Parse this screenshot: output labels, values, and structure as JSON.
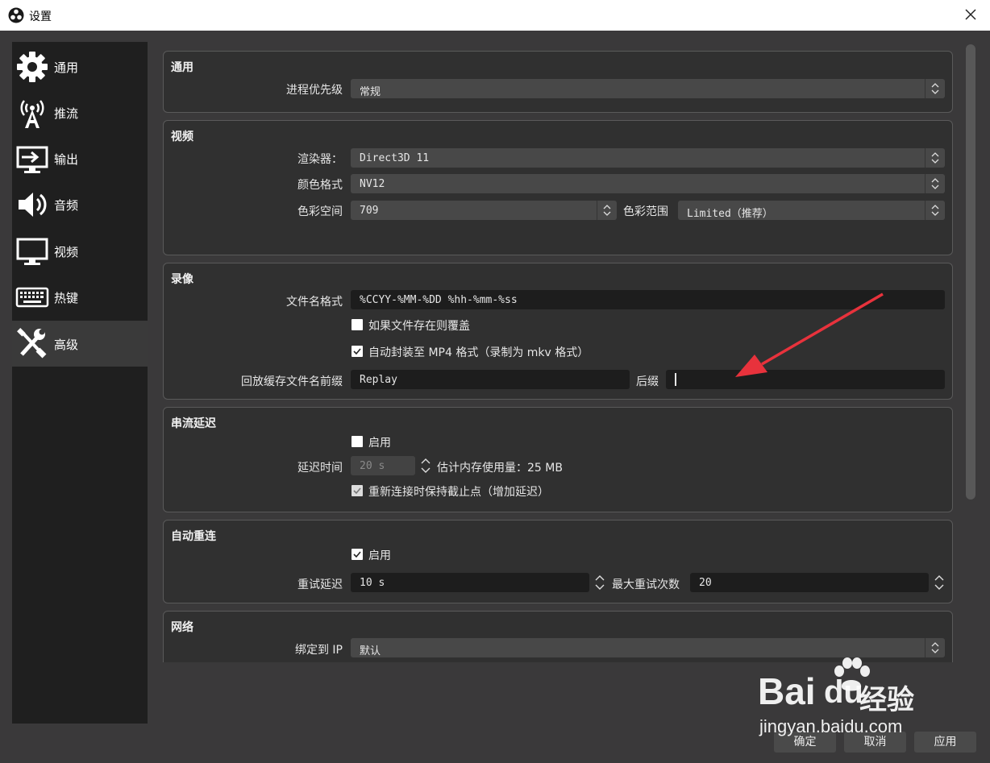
{
  "window": {
    "title": "设置"
  },
  "sidebar": {
    "items": [
      {
        "label": "通用",
        "icon": "gear-icon"
      },
      {
        "label": "推流",
        "icon": "broadcast-icon"
      },
      {
        "label": "输出",
        "icon": "output-icon"
      },
      {
        "label": "音频",
        "icon": "speaker-icon"
      },
      {
        "label": "视频",
        "icon": "monitor-icon"
      },
      {
        "label": "热键",
        "icon": "keyboard-icon"
      },
      {
        "label": "高级",
        "icon": "tools-icon",
        "active": true
      }
    ]
  },
  "general": {
    "title": "通用",
    "priority_label": "进程优先级",
    "priority_value": "常规"
  },
  "video": {
    "title": "视频",
    "renderer_label": "渲染器：",
    "renderer_value": "Direct3D 11",
    "color_format_label": "颜色格式",
    "color_format_value": "NV12",
    "color_space_label": "色彩空间",
    "color_space_value": "709",
    "color_range_label": "色彩范围",
    "color_range_value": "Limited（推荐）"
  },
  "recording": {
    "title": "录像",
    "filename_label": "文件名格式",
    "filename_value": "%CCYY-%MM-%DD %hh-%mm-%ss",
    "overwrite_label": "如果文件存在则覆盖",
    "overwrite_checked": false,
    "remux_label": "自动封装至 MP4 格式（录制为 mkv 格式）",
    "remux_checked": true,
    "replay_prefix_label": "回放缓存文件名前缀",
    "replay_prefix_value": "Replay",
    "suffix_label": "后缀",
    "suffix_value": ""
  },
  "stream_delay": {
    "title": "串流延迟",
    "enable_label": "启用",
    "enable_checked": false,
    "delay_label": "延迟时间",
    "delay_value": "20 s",
    "memory_label": "估计内存使用量：25 MB",
    "preserve_label": "重新连接时保持截止点（增加延迟）",
    "preserve_checked": true
  },
  "reconnect": {
    "title": "自动重连",
    "enable_label": "启用",
    "enable_checked": true,
    "retry_delay_label": "重试延迟",
    "retry_delay_value": "10 s",
    "max_retries_label": "最大重试次数",
    "max_retries_value": "20"
  },
  "network": {
    "title": "网络",
    "bind_ip_label": "绑定到 IP",
    "bind_ip_value": "默认"
  },
  "buttons": {
    "ok": "确定",
    "cancel": "取消",
    "apply": "应用"
  },
  "watermark": {
    "brand": "Bai",
    "brand_suffix": "du",
    "product": "经验",
    "url": "jingyan.baidu.com"
  },
  "colors": {
    "annotation_arrow": "#e8323c",
    "panel_bg": "#303030",
    "sidebar_bg": "#1f1f1f"
  }
}
